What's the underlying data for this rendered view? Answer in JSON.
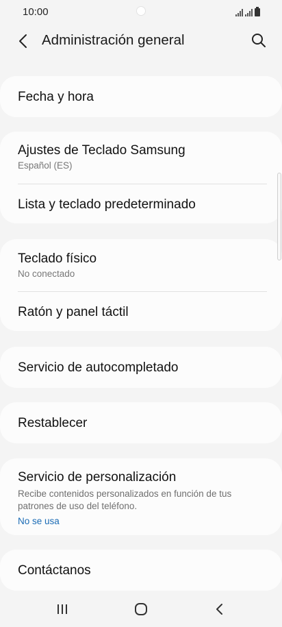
{
  "status_bar": {
    "time": "10:00",
    "icons": [
      "signal-icon",
      "signal-icon",
      "battery-icon"
    ]
  },
  "app_bar": {
    "title": "Administración general",
    "back_icon": "chevron-left-icon",
    "search_icon": "search-icon"
  },
  "groups": [
    {
      "items": [
        {
          "title": "Fecha y hora"
        }
      ]
    },
    {
      "items": [
        {
          "title": "Ajustes de Teclado Samsung",
          "subtitle": "Español (ES)"
        },
        {
          "title": "Lista y teclado predeterminado"
        }
      ]
    },
    {
      "items": [
        {
          "title": "Teclado físico",
          "subtitle": "No conectado"
        },
        {
          "title": "Ratón y panel táctil"
        }
      ]
    },
    {
      "items": [
        {
          "title": "Servicio de autocompletado"
        }
      ]
    },
    {
      "items": [
        {
          "title": "Restablecer"
        }
      ]
    },
    {
      "items": [
        {
          "title": "Servicio de personalización",
          "description": "Recibe contenidos personalizados en función de tus patrones de uso del teléfono.",
          "status": "No se usa"
        }
      ]
    },
    {
      "items": [
        {
          "title": "Contáctanos"
        }
      ]
    }
  ],
  "nav_bar": {
    "recents_icon": "recents-icon",
    "home_icon": "home-icon",
    "back_icon": "back-icon"
  },
  "colors": {
    "background": "#f4f4f4",
    "card": "#fcfcfc",
    "link": "#1a6bb5"
  }
}
